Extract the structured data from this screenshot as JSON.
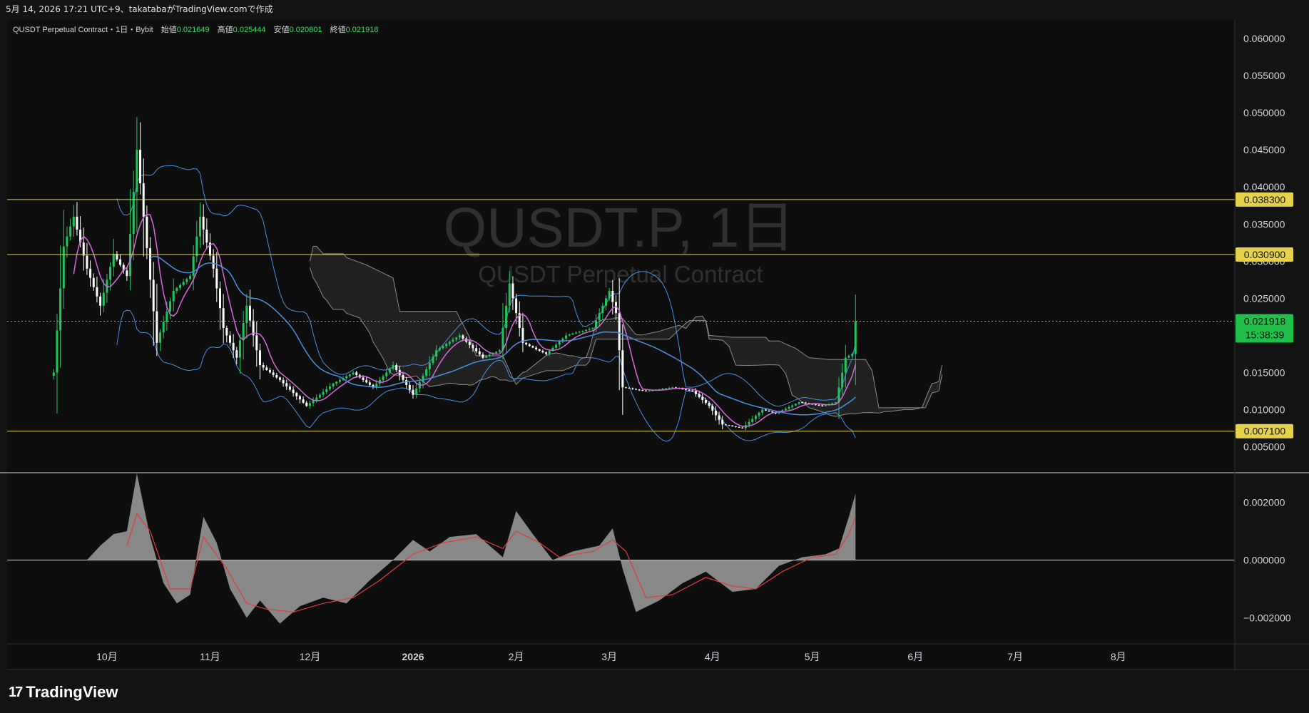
{
  "header": {
    "caption": "5月 14, 2026 17:21 UTC+9、takatabaがTradingView.comで作成"
  },
  "legend": {
    "symbol": "QUSDT Perpetual Contract・1日・Bybit",
    "open_label": "始値",
    "open_value": "0.021649",
    "high_label": "高値",
    "high_value": "0.025444",
    "low_label": "安値",
    "low_value": "0.020801",
    "close_label": "終値",
    "close_value": "0.021918"
  },
  "watermark": {
    "title": "QUSDT.P, 1日",
    "subtitle": "QUSDT Perpetual Contract"
  },
  "branding": {
    "name": "TradingView",
    "mark": "17"
  },
  "price_badge": {
    "value": "0.021918",
    "countdown": "15:38:39"
  },
  "colors": {
    "background": "#131313",
    "up": "#22c55e",
    "down": "#ffffff",
    "support_line": "#e6d24a",
    "bollinger": "#4a8fe0",
    "ma_fast": "#d36ad9",
    "ma_slow": "#4a8fe0",
    "cloud": "#8a8a8a",
    "macd_hist": "#9e9e9e",
    "signal": "#e03d3d",
    "price_badge": "#1fbf4a"
  },
  "chart_data": [
    {
      "type": "candlestick",
      "timeframe": "1日",
      "exchange": "Bybit",
      "y_ticks": [
        "0.060000",
        "0.055000",
        "0.050000",
        "0.045000",
        "0.040000",
        "0.035000",
        "0.030000",
        "0.025000",
        "0.015000",
        "0.010000",
        "0.005000"
      ],
      "ylim": [
        0.0015,
        0.0625
      ],
      "x_ticks": [
        "10月",
        "11月",
        "12月",
        "2026",
        "2月",
        "3月",
        "4月",
        "5月",
        "6月",
        "7月",
        "8月"
      ],
      "horizontal_levels": [
        {
          "value": 0.0383,
          "label": "0.038300"
        },
        {
          "value": 0.0309,
          "label": "0.030900"
        },
        {
          "value": 0.0071,
          "label": "0.007100"
        }
      ],
      "last_price": 0.021918,
      "swing_points": [
        [
          "2025-09-15",
          0.015
        ],
        [
          "2025-09-18",
          0.032
        ],
        [
          "2025-09-21",
          0.036
        ],
        [
          "2025-09-25",
          0.029
        ],
        [
          "2025-09-29",
          0.024
        ],
        [
          "2025-10-03",
          0.031
        ],
        [
          "2025-10-07",
          0.028
        ],
        [
          "2025-10-10",
          0.045
        ],
        [
          "2025-10-12",
          0.036
        ],
        [
          "2025-10-16",
          0.019
        ],
        [
          "2025-10-21",
          0.026
        ],
        [
          "2025-10-26",
          0.028
        ],
        [
          "2025-10-29",
          0.036
        ],
        [
          "2025-11-02",
          0.029
        ],
        [
          "2025-11-05",
          0.021
        ],
        [
          "2025-11-09",
          0.017
        ],
        [
          "2025-11-12",
          0.024
        ],
        [
          "2025-11-16",
          0.016
        ],
        [
          "2025-11-22",
          0.014
        ],
        [
          "2025-11-30",
          0.0105
        ],
        [
          "2025-12-08",
          0.0135
        ],
        [
          "2025-12-14",
          0.015
        ],
        [
          "2025-12-20",
          0.013
        ],
        [
          "2025-12-26",
          0.016
        ],
        [
          "2026-01-01",
          0.012
        ],
        [
          "2026-01-08",
          0.018
        ],
        [
          "2026-01-15",
          0.02
        ],
        [
          "2026-01-22",
          0.017
        ],
        [
          "2026-01-27",
          0.018
        ],
        [
          "2026-01-30",
          0.027
        ],
        [
          "2026-02-03",
          0.019
        ],
        [
          "2026-02-10",
          0.0175
        ],
        [
          "2026-02-16",
          0.02
        ],
        [
          "2026-02-24",
          0.021
        ],
        [
          "2026-03-01",
          0.026
        ],
        [
          "2026-03-03",
          0.023
        ],
        [
          "2026-03-05",
          0.013
        ],
        [
          "2026-03-12",
          0.0125
        ],
        [
          "2026-03-20",
          0.013
        ],
        [
          "2026-03-26",
          0.0125
        ],
        [
          "2026-03-31",
          0.0105
        ],
        [
          "2026-04-04",
          0.008
        ],
        [
          "2026-04-10",
          0.0075
        ],
        [
          "2026-04-16",
          0.01
        ],
        [
          "2026-04-20",
          0.0095
        ],
        [
          "2026-04-27",
          0.011
        ],
        [
          "2026-05-04",
          0.0105
        ],
        [
          "2026-05-08",
          0.011
        ],
        [
          "2026-05-11",
          0.017
        ],
        [
          "2026-05-13",
          0.0175
        ],
        [
          "2026-05-14",
          0.021918
        ]
      ]
    },
    {
      "type": "area",
      "y_ticks": [
        "0.002000",
        "0.000000",
        "−0.002000"
      ],
      "ylim": [
        -0.0029,
        0.003
      ],
      "series": [
        {
          "points": [
            [
              "2025-09-25",
              0.0
            ],
            [
              "2025-09-29",
              0.0005
            ],
            [
              "2025-10-03",
              0.0009
            ],
            [
              "2025-10-07",
              0.001
            ],
            [
              "2025-10-10",
              0.003
            ],
            [
              "2025-10-14",
              0.0008
            ],
            [
              "2025-10-18",
              -0.0008
            ],
            [
              "2025-10-22",
              -0.0015
            ],
            [
              "2025-10-26",
              -0.0012
            ],
            [
              "2025-10-30",
              0.0015
            ],
            [
              "2025-11-03",
              0.0006
            ],
            [
              "2025-11-07",
              -0.001
            ],
            [
              "2025-11-12",
              -0.002
            ],
            [
              "2025-11-16",
              -0.0014
            ],
            [
              "2025-11-22",
              -0.0022
            ],
            [
              "2025-11-28",
              -0.0016
            ],
            [
              "2025-12-05",
              -0.0013
            ],
            [
              "2025-12-12",
              -0.0015
            ],
            [
              "2025-12-19",
              -0.0007
            ],
            [
              "2025-12-26",
              0.0
            ],
            [
              "2026-01-01",
              0.0007
            ],
            [
              "2026-01-06",
              0.0003
            ],
            [
              "2026-01-12",
              0.0008
            ],
            [
              "2026-01-20",
              0.0009
            ],
            [
              "2026-01-28",
              0.0001
            ],
            [
              "2026-02-01",
              0.0017
            ],
            [
              "2026-02-06",
              0.0009
            ],
            [
              "2026-02-12",
              0.0
            ],
            [
              "2026-02-18",
              0.0003
            ],
            [
              "2026-02-26",
              0.0005
            ],
            [
              "2026-03-02",
              0.0011
            ],
            [
              "2026-03-05",
              -0.0003
            ],
            [
              "2026-03-09",
              -0.0018
            ],
            [
              "2026-03-16",
              -0.0014
            ],
            [
              "2026-03-23",
              -0.0008
            ],
            [
              "2026-03-30",
              -0.0004
            ],
            [
              "2026-04-07",
              -0.0011
            ],
            [
              "2026-04-14",
              -0.001
            ],
            [
              "2026-04-21",
              -0.0002
            ],
            [
              "2026-04-28",
              0.0001
            ],
            [
              "2026-05-05",
              0.0002
            ],
            [
              "2026-05-09",
              0.0004
            ],
            [
              "2026-05-12",
              0.0015
            ],
            [
              "2026-05-14",
              0.0023
            ]
          ]
        },
        {
          "points": [
            [
              "2025-10-07",
              0.0005
            ],
            [
              "2025-10-10",
              0.0016
            ],
            [
              "2025-10-14",
              0.001
            ],
            [
              "2025-10-20",
              -0.001
            ],
            [
              "2025-10-26",
              -0.001
            ],
            [
              "2025-10-30",
              0.0008
            ],
            [
              "2025-11-06",
              -0.0003
            ],
            [
              "2025-11-12",
              -0.0015
            ],
            [
              "2025-11-18",
              -0.0017
            ],
            [
              "2025-11-26",
              -0.0018
            ],
            [
              "2025-12-05",
              -0.0015
            ],
            [
              "2025-12-14",
              -0.0013
            ],
            [
              "2025-12-22",
              -0.0007
            ],
            [
              "2026-01-01",
              0.0002
            ],
            [
              "2026-01-10",
              0.0006
            ],
            [
              "2026-01-20",
              0.0008
            ],
            [
              "2026-01-28",
              0.0004
            ],
            [
              "2026-02-01",
              0.001
            ],
            [
              "2026-02-08",
              0.0006
            ],
            [
              "2026-02-14",
              0.0001
            ],
            [
              "2026-02-24",
              0.0003
            ],
            [
              "2026-03-02",
              0.0007
            ],
            [
              "2026-03-06",
              0.0003
            ],
            [
              "2026-03-12",
              -0.0013
            ],
            [
              "2026-03-20",
              -0.0012
            ],
            [
              "2026-03-30",
              -0.0006
            ],
            [
              "2026-04-07",
              -0.0009
            ],
            [
              "2026-04-14",
              -0.001
            ],
            [
              "2026-04-22",
              -0.0004
            ],
            [
              "2026-05-01",
              0.0001
            ],
            [
              "2026-05-08",
              0.0002
            ],
            [
              "2026-05-12",
              0.0009
            ],
            [
              "2026-05-14",
              0.0015
            ]
          ]
        }
      ]
    }
  ]
}
